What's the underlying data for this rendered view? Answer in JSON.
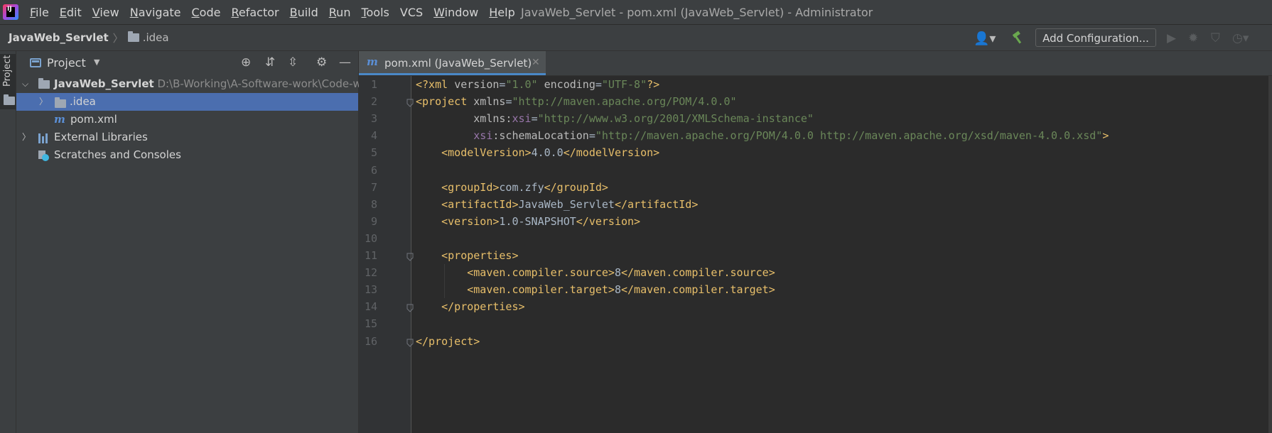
{
  "menu": {
    "items": [
      {
        "u": "F",
        "rest": "ile"
      },
      {
        "u": "E",
        "rest": "dit"
      },
      {
        "u": "V",
        "rest": "iew"
      },
      {
        "u": "N",
        "rest": "avigate"
      },
      {
        "u": "C",
        "rest": "ode"
      },
      {
        "u": "R",
        "rest": "efactor"
      },
      {
        "u": "B",
        "rest": "uild"
      },
      {
        "u": "R",
        "rest": "un"
      },
      {
        "u": "T",
        "rest": "ools"
      },
      {
        "u": "",
        "rest": "VCS"
      },
      {
        "u": "W",
        "rest": "indow"
      },
      {
        "u": "H",
        "rest": "elp"
      }
    ]
  },
  "window_title": "JavaWeb_Servlet - pom.xml (JavaWeb_Servlet) - Administrator",
  "breadcrumb": {
    "root": "JavaWeb_Servlet",
    "child": ".idea"
  },
  "toolbar": {
    "add_configuration": "Add Configuration..."
  },
  "strip": {
    "project_label": "Project"
  },
  "project_panel": {
    "title": "Project",
    "tree": {
      "root_name": "JavaWeb_Servlet",
      "root_path": "D:\\B-Working\\A-Software-work\\Code-w",
      "idea": ".idea",
      "pom": "pom.xml",
      "external_libraries": "External Libraries",
      "scratches": "Scratches and Consoles"
    }
  },
  "editor": {
    "tab_label": "pom.xml (JavaWeb_Servlet)",
    "line_numbers": [
      "1",
      "2",
      "3",
      "4",
      "5",
      "6",
      "7",
      "8",
      "9",
      "10",
      "11",
      "12",
      "13",
      "14",
      "15",
      "16"
    ],
    "lines": [
      [
        {
          "c": "tag",
          "t": "<?xml "
        },
        {
          "c": "attr",
          "t": "version"
        },
        {
          "c": "txt",
          "t": "="
        },
        {
          "c": "val",
          "t": "\"1.0\""
        },
        {
          "c": "attr",
          "t": " encoding"
        },
        {
          "c": "txt",
          "t": "="
        },
        {
          "c": "val",
          "t": "\"UTF-8\""
        },
        {
          "c": "tag",
          "t": "?>"
        }
      ],
      [
        {
          "c": "tag",
          "t": "<project "
        },
        {
          "c": "attr",
          "t": "xmlns"
        },
        {
          "c": "txt",
          "t": "="
        },
        {
          "c": "val",
          "t": "\"http://maven.apache.org/POM/4.0.0\""
        }
      ],
      [
        {
          "c": "attr",
          "t": "         xmlns:"
        },
        {
          "c": "ns",
          "t": "xsi"
        },
        {
          "c": "txt",
          "t": "="
        },
        {
          "c": "val",
          "t": "\"http://www.w3.org/2001/XMLSchema-instance\""
        }
      ],
      [
        {
          "c": "ns",
          "t": "         xsi"
        },
        {
          "c": "attr",
          "t": ":schemaLocation"
        },
        {
          "c": "txt",
          "t": "="
        },
        {
          "c": "val",
          "t": "\"http://maven.apache.org/POM/4.0.0 http://maven.apache.org/xsd/maven-4.0.0.xsd\""
        },
        {
          "c": "tag",
          "t": ">"
        }
      ],
      [
        {
          "c": "tag",
          "t": "    <modelVersion>"
        },
        {
          "c": "txt",
          "t": "4.0.0"
        },
        {
          "c": "tag",
          "t": "</modelVersion>"
        }
      ],
      [],
      [
        {
          "c": "tag",
          "t": "    <groupId>"
        },
        {
          "c": "txt",
          "t": "com.zfy"
        },
        {
          "c": "tag",
          "t": "</groupId>"
        }
      ],
      [
        {
          "c": "tag",
          "t": "    <artifactId>"
        },
        {
          "c": "txt",
          "t": "JavaWeb_Servlet"
        },
        {
          "c": "tag",
          "t": "</artifactId>"
        }
      ],
      [
        {
          "c": "tag",
          "t": "    <version>"
        },
        {
          "c": "txt",
          "t": "1.0-SNAPSHOT"
        },
        {
          "c": "tag",
          "t": "</version>"
        }
      ],
      [],
      [
        {
          "c": "tag",
          "t": "    <properties>"
        }
      ],
      [
        {
          "c": "tag",
          "t": "        <maven.compiler.source>"
        },
        {
          "c": "txt",
          "t": "8"
        },
        {
          "c": "tag",
          "t": "</maven.compiler.source>"
        }
      ],
      [
        {
          "c": "tag",
          "t": "        <maven.compiler.target>"
        },
        {
          "c": "txt",
          "t": "8"
        },
        {
          "c": "tag",
          "t": "</maven.compiler.target>"
        }
      ],
      [
        {
          "c": "tag",
          "t": "    </properties>"
        }
      ],
      [],
      [
        {
          "c": "tag",
          "t": "</project>"
        }
      ]
    ]
  },
  "colors": {
    "accent": "#4b6eaf",
    "tag": "#e8bf6a",
    "string": "#6a8759",
    "namespace": "#9876aa"
  }
}
